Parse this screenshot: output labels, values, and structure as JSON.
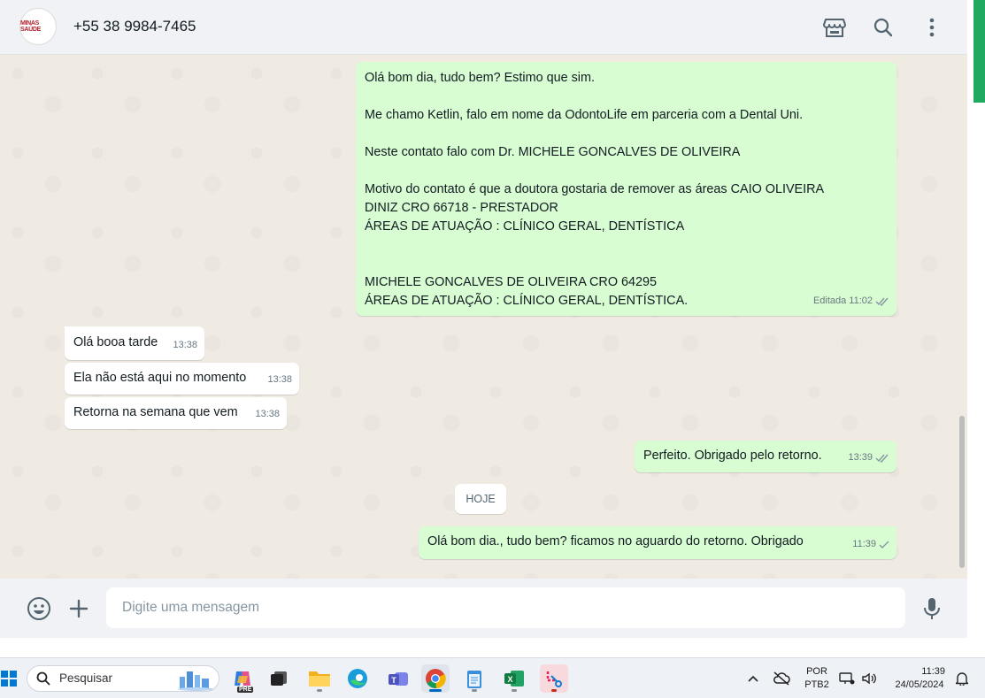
{
  "header": {
    "avatar_text": "MINAS SAÚDE",
    "contact": "+55 38 9984-7465"
  },
  "messages": {
    "m1": {
      "lines": "Olá bom dia, tudo bem? Estimo que sim.\n\nMe chamo Ketlin, falo em nome da OdontoLife em parceria com a Dental Uni.\n\nNeste contato falo com Dr. MICHELE GONCALVES DE OLIVEIRA\n\nMotivo do contato é que a doutora gostaria de remover as áreas CAIO OLIVEIRA\nDINIZ CRO 66718 - PRESTADOR\nÁREAS DE ATUAÇÃO : CLÍNICO GERAL, DENTÍSTICA\n\n\nMICHELE GONCALVES DE OLIVEIRA CRO 64295\nÁREAS DE ATUAÇÃO : CLÍNICO GERAL, DENTÍSTICA.",
      "edited": "Editada",
      "time": "11:02"
    },
    "m2": {
      "text": "Olá booa tarde",
      "time": "13:38"
    },
    "m3": {
      "text": "Ela não está aqui no momento",
      "time": "13:38"
    },
    "m4": {
      "text": "Retorna na semana que vem",
      "time": "13:38"
    },
    "m5": {
      "text": "Perfeito. Obrigado pelo retorno.",
      "time": "13:39"
    },
    "date_divider": "HOJE",
    "m6": {
      "text": "Olá bom dia., tudo bem? ficamos no aguardo do retorno. Obrigado",
      "time": "11:39"
    }
  },
  "footer": {
    "placeholder": "Digite uma mensagem"
  },
  "taskbar": {
    "search_placeholder": "Pesquisar",
    "lang_line1": "POR",
    "lang_line2": "PTB2",
    "time": "11:39",
    "date": "24/05/2024",
    "pre_badge": "PRE"
  },
  "colors": {
    "outgoing": "#d9fdd3",
    "incoming": "#ffffff",
    "chat_bg": "#efeae2",
    "read_tick": "#8696a0"
  }
}
